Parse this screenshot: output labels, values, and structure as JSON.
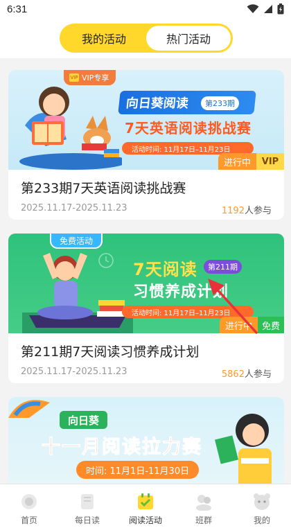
{
  "status_bar": {
    "time": "6:31"
  },
  "segment": {
    "tabs": [
      {
        "label": "我的活动",
        "active": false
      },
      {
        "label": "热门活动",
        "active": true
      }
    ]
  },
  "cards": [
    {
      "badge": "VIP专享",
      "banner_brand": "向日葵阅读",
      "banner_period": "第233期",
      "banner_title": "7天英语阅读挑战赛",
      "banner_time": "活动时间: 11月17日–11月23日",
      "status": "进行中",
      "tag": "VIP",
      "title": "第233期7天英语阅读挑战赛",
      "date_range": "2025.11.17-2025.11.23",
      "participants": "1192",
      "participants_suffix": "人参与"
    },
    {
      "badge": "免费活动",
      "banner_brand": "7天阅读",
      "banner_period": "第211期",
      "banner_title": "习惯养成计划",
      "banner_time": "活动时间: 11月17日–11月23日",
      "status": "进行中",
      "tag": "免费",
      "title": "第211期7天阅读习惯养成计划",
      "date_range": "2025.11.17-2025.11.23",
      "participants": "5862",
      "participants_suffix": "人参与"
    },
    {
      "banner_brand": "向日葵",
      "banner_title": "十一月阅读拉力赛",
      "banner_time": "时间: 11月1日-11月30日"
    }
  ],
  "tabbar": {
    "items": [
      {
        "label": "首页",
        "icon": "home-icon",
        "active": false
      },
      {
        "label": "每日读",
        "icon": "book-icon",
        "active": false
      },
      {
        "label": "阅读活动",
        "icon": "calendar-check-icon",
        "active": true
      },
      {
        "label": "班群",
        "icon": "group-icon",
        "active": false
      },
      {
        "label": "我的",
        "icon": "profile-icon",
        "active": false
      }
    ]
  },
  "colors": {
    "accent_yellow": "#ffd82b",
    "orange": "#ff9a2a",
    "green": "#2dbf55"
  }
}
